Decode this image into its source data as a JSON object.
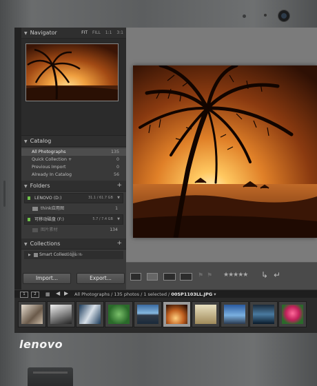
{
  "device": {
    "brand": "lenovo"
  },
  "navigator": {
    "title": "Navigator",
    "zoom_options": [
      "FIT",
      "FILL",
      "1:1",
      "3:1"
    ],
    "active_zoom": "FIT"
  },
  "catalog": {
    "title": "Catalog",
    "items": [
      {
        "label": "All Photographs",
        "count": "135",
        "selected": true
      },
      {
        "label": "Quick Collection +",
        "count": "0"
      },
      {
        "label": "Previous Import",
        "count": "0"
      },
      {
        "label": "Already In Catalog",
        "count": "56"
      }
    ]
  },
  "folders": {
    "title": "Folders",
    "volumes": [
      {
        "label": "LENOVO (D:)",
        "capacity": "31.1 / 61.7 GB",
        "subfolders": [
          {
            "label": "think应用图",
            "count": "1"
          }
        ]
      },
      {
        "label": "可移动磁盘 (F:)",
        "capacity": "5.7 / 7.4 GB",
        "subfolders": [
          {
            "label": "图片素材",
            "count": "134",
            "dim": true
          }
        ]
      }
    ]
  },
  "collections": {
    "title": "Collections",
    "items": [
      {
        "label": "Smart Collections"
      }
    ]
  },
  "buttons": {
    "import": "Import...",
    "export": "Export..."
  },
  "filmstrip_bar": {
    "page1": "1",
    "page2": "2",
    "source": "All Photographs",
    "info": " / 135 photos / 1 selected /",
    "filename": "00SP1103LL.JPG"
  },
  "colors": {
    "panel": "#393939",
    "workspace": "#7b7b7b",
    "selected_row": "#4d4d4d"
  }
}
